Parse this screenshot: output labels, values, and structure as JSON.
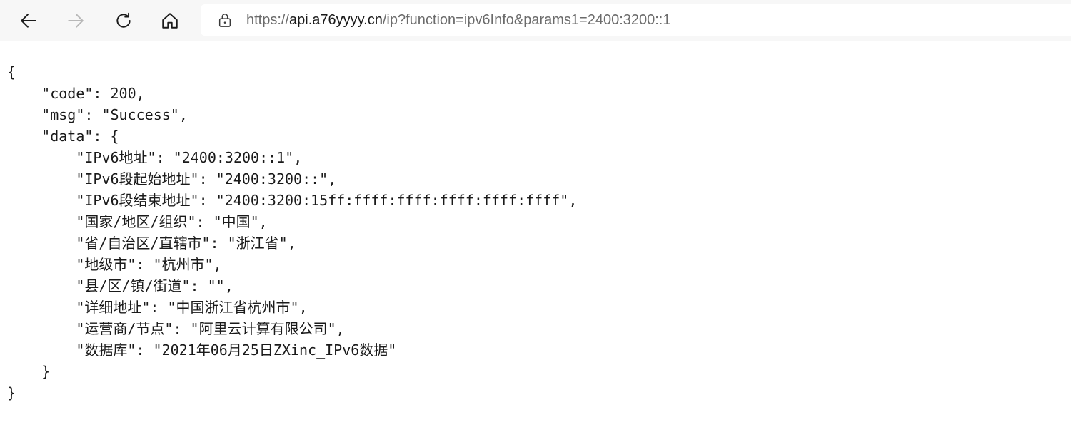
{
  "browser": {
    "url_scheme": "https://",
    "url_host": "api.a76yyyy.cn",
    "url_rest": "/ip?function=ipv6Info&params1=2400:3200::1"
  },
  "json_lines": [
    "{",
    "    \"code\": 200,",
    "    \"msg\": \"Success\",",
    "    \"data\": {",
    "        \"IPv6地址\": \"2400:3200::1\",",
    "        \"IPv6段起始地址\": \"2400:3200::\",",
    "        \"IPv6段结束地址\": \"2400:3200:15ff:ffff:ffff:ffff:ffff:ffff\",",
    "        \"国家/地区/组织\": \"中国\",",
    "        \"省/自治区/直辖市\": \"浙江省\",",
    "        \"地级市\": \"杭州市\",",
    "        \"县/区/镇/街道\": \"\",",
    "        \"详细地址\": \"中国浙江省杭州市\",",
    "        \"运营商/节点\": \"阿里云计算有限公司\",",
    "        \"数据库\": \"2021年06月25日ZXinc_IPv6数据\"",
    "    }",
    "}"
  ]
}
